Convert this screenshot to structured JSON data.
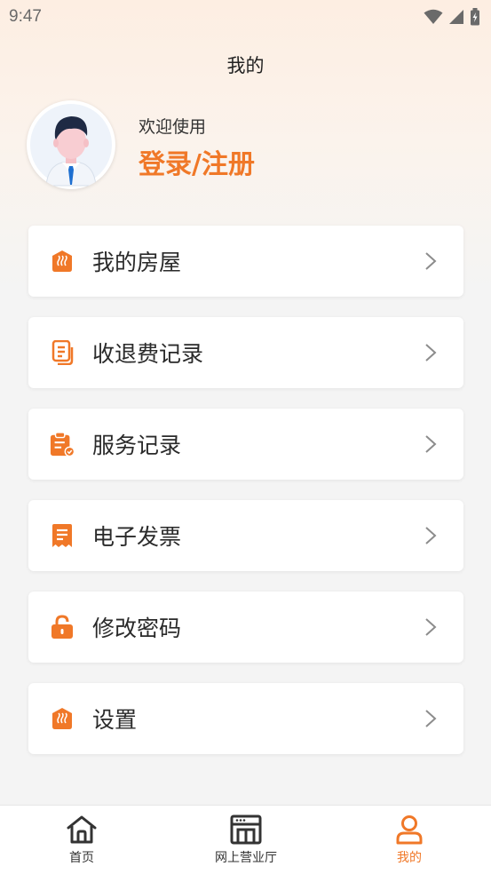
{
  "status_bar": {
    "time": "9:47"
  },
  "header": {
    "title": "我的"
  },
  "profile": {
    "welcome_text": "欢迎使用",
    "login_label": "登录/注册"
  },
  "menu": {
    "items": [
      {
        "label": "我的房屋",
        "icon": "house-icon"
      },
      {
        "label": "收退费记录",
        "icon": "document-icon"
      },
      {
        "label": "服务记录",
        "icon": "clipboard-check-icon"
      },
      {
        "label": "电子发票",
        "icon": "receipt-icon"
      },
      {
        "label": "修改密码",
        "icon": "lock-icon"
      },
      {
        "label": "设置",
        "icon": "house-icon"
      }
    ]
  },
  "tab_bar": {
    "tabs": [
      {
        "label": "首页",
        "icon": "home-icon"
      },
      {
        "label": "网上营业厅",
        "icon": "storefront-icon"
      },
      {
        "label": "我的",
        "icon": "person-icon",
        "active": true
      }
    ]
  },
  "colors": {
    "accent": "#f07828",
    "background": "#f4f4f4"
  }
}
